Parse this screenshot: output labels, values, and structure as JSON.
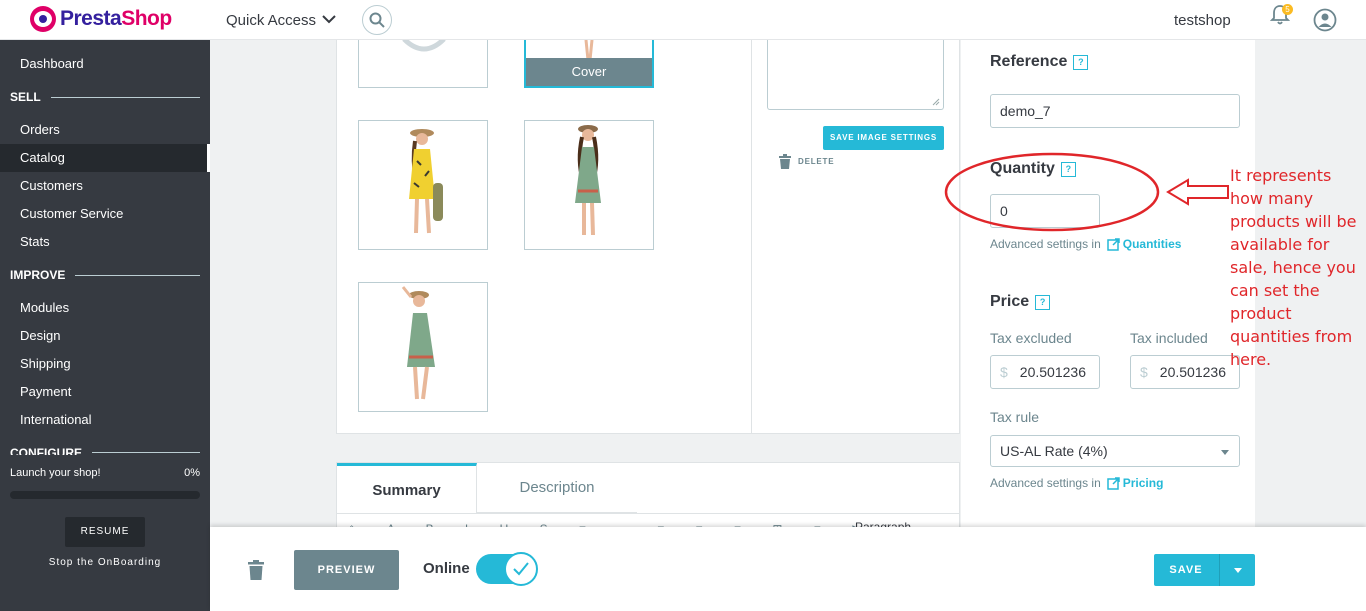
{
  "header": {
    "logo_text_a": "Presta",
    "logo_text_b": "Shop",
    "quick_access": "Quick Access",
    "shop_name": "testshop",
    "notification_count": "5"
  },
  "sidebar": {
    "dashboard": "Dashboard",
    "sections": [
      {
        "title": "SELL"
      },
      {
        "title": "IMPROVE"
      },
      {
        "title": "CONFIGURE"
      }
    ],
    "items": [
      {
        "label": "Orders"
      },
      {
        "label": "Catalog"
      },
      {
        "label": "Customers"
      },
      {
        "label": "Customer Service"
      },
      {
        "label": "Stats"
      },
      {
        "label": "Modules"
      },
      {
        "label": "Design"
      },
      {
        "label": "Shipping"
      },
      {
        "label": "Payment"
      },
      {
        "label": "International"
      }
    ],
    "launch_label": "Launch your shop!",
    "launch_percent": "0%",
    "resume": "RESUME",
    "stop_onboarding": "Stop the OnBoarding"
  },
  "images": {
    "cover_label": "Cover",
    "save_image_settings": "SAVE IMAGE SETTINGS",
    "delete": "DELETE"
  },
  "tabs": {
    "summary": "Summary",
    "description": "Description",
    "toolbar_format": "Paragraph"
  },
  "right": {
    "reference_label": "Reference",
    "reference_value": "demo_7",
    "quantity_label": "Quantity",
    "quantity_value": "0",
    "advanced_settings": "Advanced settings in",
    "quantities_link": "Quantities",
    "price_label": "Price",
    "tax_excluded_label": "Tax excluded",
    "tax_included_label": "Tax included",
    "currency_symbol": "$",
    "tax_excluded_value": "20.501236",
    "tax_included_value": "20.501236",
    "tax_rule_label": "Tax rule",
    "tax_rule_value": "US-AL Rate (4%)",
    "pricing_link": "Pricing"
  },
  "annotation": {
    "text": "It represents how many products will be available for sale, hence you can set the product quantities from here.",
    "color": "#e0262a"
  },
  "footer": {
    "preview": "PREVIEW",
    "online": "Online",
    "online_enabled": true,
    "save": "SAVE"
  },
  "colors": {
    "accent": "#25b9d7",
    "sidebar_bg": "#363a41",
    "brand_pink": "#df0067",
    "brand_purple": "#34209e"
  }
}
